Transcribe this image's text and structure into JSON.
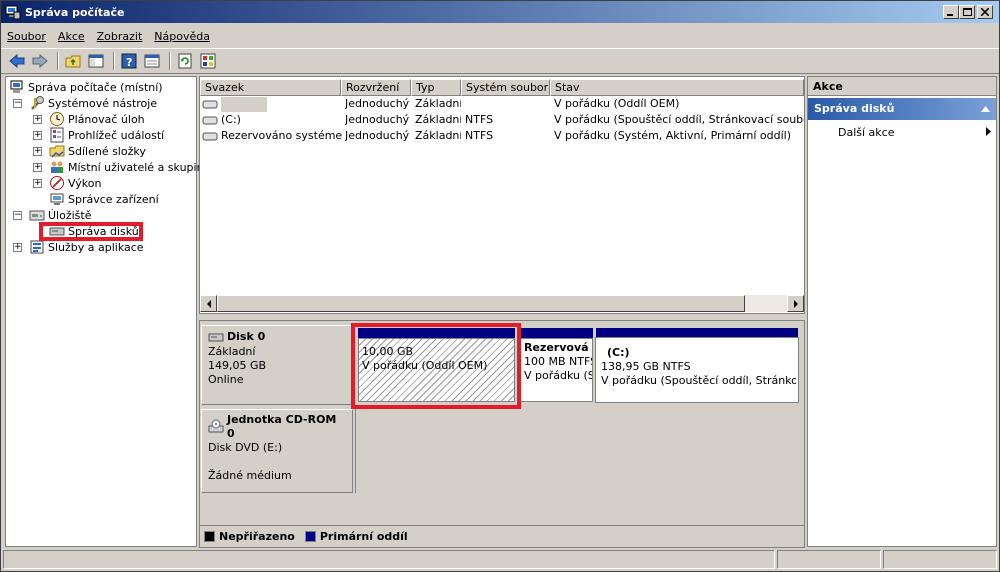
{
  "window": {
    "title": "Správa počítače"
  },
  "menu": [
    "Soubor",
    "Akce",
    "Zobrazit",
    "Nápověda"
  ],
  "tree": {
    "root": "Správa počítače (místní)",
    "items": [
      {
        "label": "Systémové nástroje",
        "exp": "−"
      },
      {
        "label": "Plánovač úloh",
        "exp": "+"
      },
      {
        "label": "Prohlížeč událostí",
        "exp": "+"
      },
      {
        "label": "Sdílené složky",
        "exp": "+"
      },
      {
        "label": "Místní uživatelé a skupiny",
        "exp": "+"
      },
      {
        "label": "Výkon",
        "exp": "+"
      },
      {
        "label": "Správce zařízení",
        "exp": ""
      },
      {
        "label": "Úložiště",
        "exp": "−"
      },
      {
        "label": "Správa disků",
        "exp": ""
      },
      {
        "label": "Služby a aplikace",
        "exp": "+"
      }
    ]
  },
  "volumes": {
    "headers": [
      "Svazek",
      "Rozvržení",
      "Typ",
      "Systém souborů",
      "Stav"
    ],
    "rows": [
      [
        "",
        "Jednoduchý",
        "Základní",
        "",
        "V pořádku (Oddíl OEM)"
      ],
      [
        "(C:)",
        "Jednoduchý",
        "Základní",
        "NTFS",
        "V pořádku (Spouštěcí oddíl, Stránkovací soubor, Pr"
      ],
      [
        "Rezervováno systémem",
        "Jednoduchý",
        "Základní",
        "NTFS",
        "V pořádku (Systém, Aktivní, Primární oddíl)"
      ]
    ]
  },
  "disk0": {
    "name": "Disk 0",
    "type": "Základní",
    "size": "149,05 GB",
    "status": "Online",
    "partitions": [
      {
        "title": "",
        "size": "10,00 GB",
        "status": "V pořádku (Oddíl OEM)"
      },
      {
        "title": "Rezervová",
        "size": "100 MB NTFS",
        "status": "V pořádku (Sy"
      },
      {
        "title": "(C:)",
        "size": "138,95 GB NTFS",
        "status": "V pořádku (Spouštěcí oddíl, Stránkovací"
      }
    ]
  },
  "cdrom": {
    "name": "Jednotka CD-ROM 0",
    "type": "Disk DVD (E:)",
    "status": "Žádné médium"
  },
  "legend": [
    {
      "label": "Nepřiřazeno",
      "color": "#000000"
    },
    {
      "label": "Primární oddíl",
      "color": "#000080"
    }
  ],
  "actions": {
    "header": "Akce",
    "section": "Správa disků",
    "more": "Další akce"
  },
  "colors": {
    "highlight": "#e21c2a",
    "primary": "#000080"
  }
}
